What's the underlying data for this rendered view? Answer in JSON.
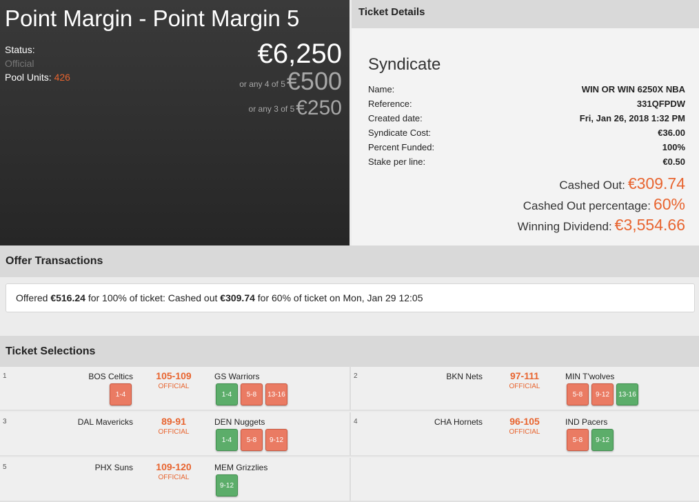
{
  "pool": {
    "title": "Point Margin - Point Margin 5",
    "status_label": "Status:",
    "status_value": "Official",
    "pool_units_label": "Pool Units:",
    "pool_units_value": "426",
    "prize_main": "€6,250",
    "prize_4_label": "or any 4 of 5",
    "prize_4_value": "€500",
    "prize_3_label": "or any 3 of 5",
    "prize_3_value": "€250"
  },
  "details": {
    "header": "Ticket Details",
    "title": "Syndicate",
    "name_label": "Name:",
    "name_value": "WIN OR WIN 6250X NBA",
    "reference_label": "Reference:",
    "reference_value": "331QFPDW",
    "created_label": "Created date:",
    "created_value": "Fri, Jan 26, 2018 1:32 PM",
    "cost_label": "Syndicate Cost:",
    "cost_value": "€36.00",
    "funded_label": "Percent Funded:",
    "funded_value": "100%",
    "stake_label": "Stake per line:",
    "stake_value": "€0.50",
    "cashed_out_label": "Cashed Out:",
    "cashed_out_value": "€309.74",
    "cashed_pct_label": "Cashed Out percentage:",
    "cashed_pct_value": "60%",
    "dividend_label": "Winning Dividend:",
    "dividend_value": "€3,554.66"
  },
  "offers": {
    "header": "Offer Transactions",
    "t1": "Offered ",
    "offered_amount": "€516.24",
    "t2": " for 100% of ticket: Cashed out ",
    "cashed_amount": "€309.74",
    "t3": " for 60% of ticket on Mon, Jan 29 12:05"
  },
  "selections": {
    "header": "Ticket Selections",
    "items": [
      {
        "num": "1",
        "home": "BOS Celtics",
        "score": "105-109",
        "status": "OFFICIAL",
        "away": "GS Warriors",
        "home_chips": [
          {
            "label": "1-4",
            "state": "red"
          }
        ],
        "away_chips": [
          {
            "label": "1-4",
            "state": "green"
          },
          {
            "label": "5-8",
            "state": "red"
          },
          {
            "label": "13-16",
            "state": "red"
          }
        ]
      },
      {
        "num": "2",
        "home": "BKN Nets",
        "score": "97-111",
        "status": "OFFICIAL",
        "away": "MIN T'wolves",
        "home_chips": [],
        "away_chips": [
          {
            "label": "5-8",
            "state": "red"
          },
          {
            "label": "9-12",
            "state": "red"
          },
          {
            "label": "13-16",
            "state": "green"
          }
        ]
      },
      {
        "num": "3",
        "home": "DAL Mavericks",
        "score": "89-91",
        "status": "OFFICIAL",
        "away": "DEN Nuggets",
        "home_chips": [],
        "away_chips": [
          {
            "label": "1-4",
            "state": "green"
          },
          {
            "label": "5-8",
            "state": "red"
          },
          {
            "label": "9-12",
            "state": "red"
          }
        ]
      },
      {
        "num": "4",
        "home": "CHA Hornets",
        "score": "96-105",
        "status": "OFFICIAL",
        "away": "IND Pacers",
        "home_chips": [],
        "away_chips": [
          {
            "label": "5-8",
            "state": "red"
          },
          {
            "label": "9-12",
            "state": "green"
          }
        ]
      },
      {
        "num": "5",
        "home": "PHX Suns",
        "score": "109-120",
        "status": "OFFICIAL",
        "away": "MEM Grizzlies",
        "home_chips": [],
        "away_chips": [
          {
            "label": "9-12",
            "state": "green"
          }
        ]
      }
    ]
  }
}
